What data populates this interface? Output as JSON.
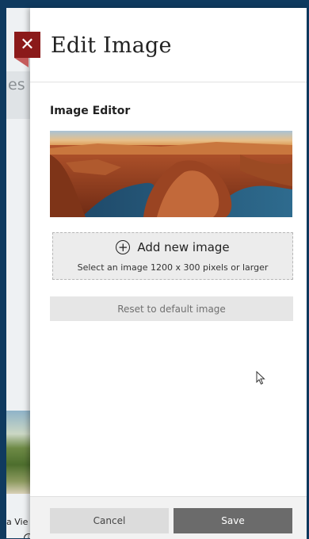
{
  "background_page": {
    "tab_text_fragment": "es",
    "caption_fragment": "a Vie",
    "info_icon": "info-icon"
  },
  "close_button": {
    "icon": "close-icon",
    "glyph": "✕"
  },
  "panel": {
    "title": "Edit Image",
    "section_label": "Image Editor",
    "banner_image": "canyon-river-banner",
    "add_image": {
      "icon": "plus-circle-icon",
      "icon_glyph": "+",
      "label": "Add new image",
      "hint": "Select an image 1200 x 300 pixels or larger"
    },
    "reset_label": "Reset to default image",
    "footer": {
      "cancel_label": "Cancel",
      "save_label": "Save"
    }
  },
  "colors": {
    "frame": "#0f3a5f",
    "close_button": "#8b1a1a",
    "save_button": "#6b6b6b",
    "cancel_button": "#dcdcdc"
  }
}
